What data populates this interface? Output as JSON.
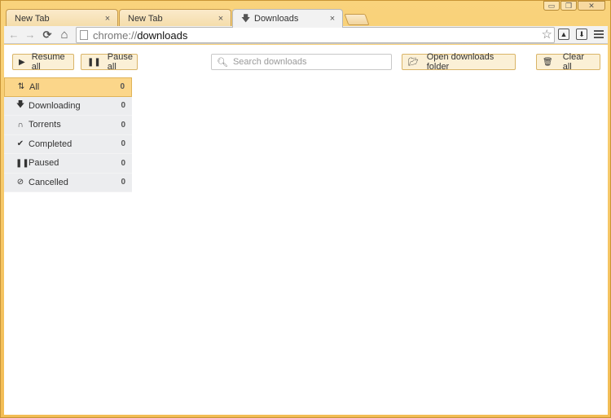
{
  "tabs": [
    {
      "label": "New Tab",
      "close": "×"
    },
    {
      "label": "New Tab",
      "close": "×"
    },
    {
      "label": "Downloads",
      "close": "×",
      "icon": "download-arrow-icon"
    }
  ],
  "window_controls": {
    "minimize": "▭",
    "restore": "❐",
    "close": "✕"
  },
  "toolbar": {
    "back": "←",
    "forward": "→",
    "reload": "⟳",
    "home": "⌂",
    "url_scheme": "chrome://",
    "url_path": "downloads",
    "bookmark_star": "☆"
  },
  "actions": {
    "resume_all": "Resume all",
    "pause_all": "Pause all",
    "open_folder": "Open downloads folder",
    "clear_all": "Clear all"
  },
  "search": {
    "placeholder": "Search downloads"
  },
  "sidebar": {
    "items": [
      {
        "label": "All",
        "count": "0",
        "icon": "sort-arrows-icon"
      },
      {
        "label": "Downloading",
        "count": "0",
        "icon": "down-arrow-icon"
      },
      {
        "label": "Torrents",
        "count": "0",
        "icon": "magnet-icon"
      },
      {
        "label": "Completed",
        "count": "0",
        "icon": "check-icon"
      },
      {
        "label": "Paused",
        "count": "0",
        "icon": "pause-icon"
      },
      {
        "label": "Cancelled",
        "count": "0",
        "icon": "cancel-icon"
      }
    ]
  },
  "colors": {
    "accent": "#f3bd55",
    "active_item": "#fbd68a",
    "button_bg": "#fbf0d6"
  }
}
